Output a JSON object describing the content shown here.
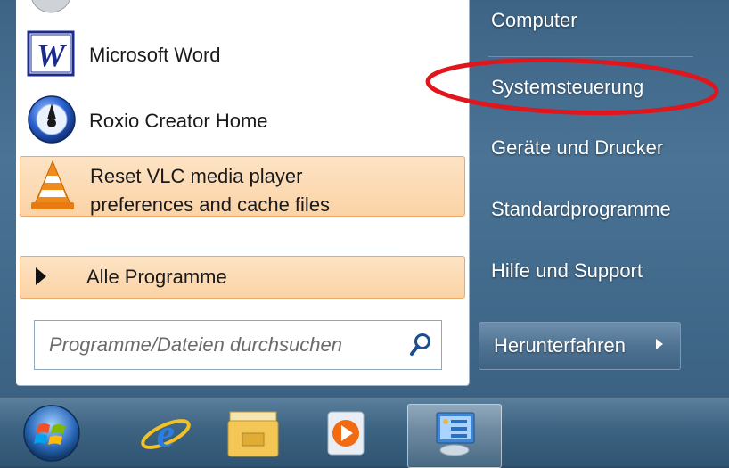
{
  "programs": [
    {
      "label": "Microsoft Word",
      "icon": "word-icon"
    },
    {
      "label": "Roxio Creator Home",
      "icon": "roxio-icon"
    },
    {
      "label": "Reset VLC media player preferences and cache files",
      "line1": "Reset VLC media player",
      "line2": "preferences and cache files",
      "icon": "vlc-icon"
    }
  ],
  "all_programs": {
    "label": "Alle Programme"
  },
  "search": {
    "placeholder": "Programme/Dateien durchsuchen"
  },
  "right_pane": {
    "items": [
      {
        "label": "Computer"
      },
      {
        "label": "Systemsteuerung"
      },
      {
        "label": "Geräte und Drucker"
      },
      {
        "label": "Standardprogramme"
      },
      {
        "label": "Hilfe und Support"
      }
    ]
  },
  "shutdown": {
    "label": "Herunterfahren"
  },
  "taskbar": {
    "items": [
      "start-orb-icon",
      "internet-explorer-icon",
      "file-explorer-icon",
      "media-player-icon",
      "control-panel-icon"
    ]
  },
  "colors": {
    "highlight": "#fbd3a6",
    "annotation_red": "#e0161c",
    "menu_blue": "#4a7395"
  }
}
